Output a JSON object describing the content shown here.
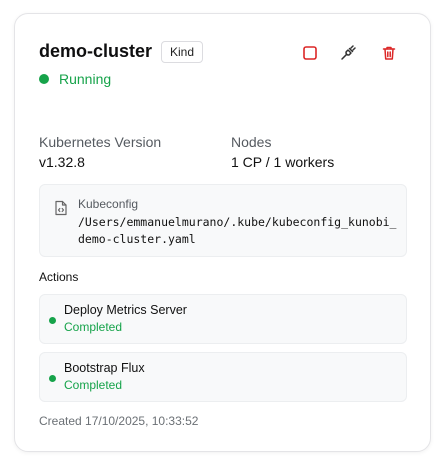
{
  "cluster": {
    "name": "demo-cluster",
    "kind_badge": "Kind",
    "status": "Running"
  },
  "header_actions": {
    "stop_icon": "stop-square-icon",
    "connect_icon": "plug-icon",
    "delete_icon": "trash-icon"
  },
  "meta": {
    "k8s_version_label": "Kubernetes Version",
    "k8s_version_value": "v1.32.8",
    "nodes_label": "Nodes",
    "nodes_value": "1 CP / 1 workers"
  },
  "kubeconfig": {
    "label": "Kubeconfig",
    "path": "/Users/emmanuelmurano/.kube/kubeconfig_kunobi_demo-cluster.yaml"
  },
  "actions": {
    "title": "Actions",
    "items": [
      {
        "name": "Deploy Metrics Server",
        "status": "Completed"
      },
      {
        "name": "Bootstrap Flux",
        "status": "Completed"
      }
    ]
  },
  "created": "Created 17/10/2025, 10:33:52",
  "colors": {
    "success": "#16a34a",
    "danger": "#dc2626"
  }
}
